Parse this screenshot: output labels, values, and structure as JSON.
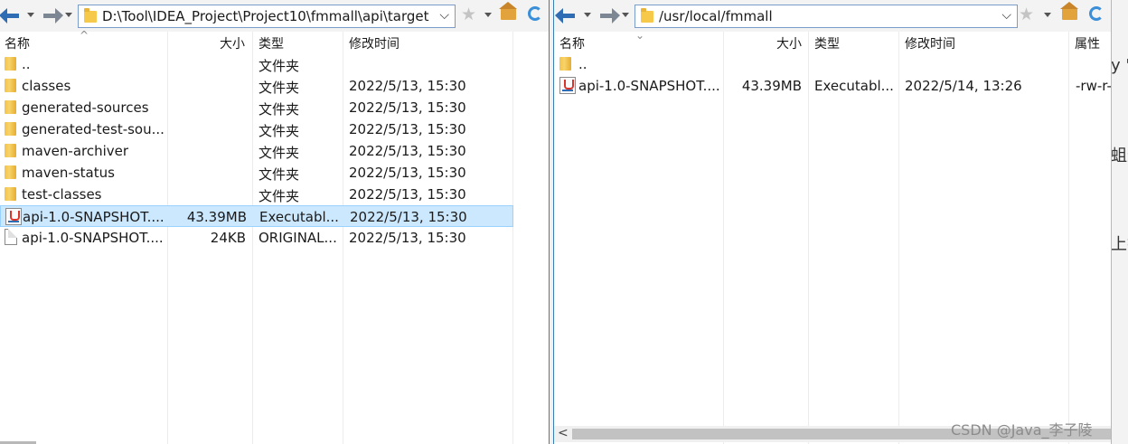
{
  "left": {
    "path": "D:\\Tool\\IDEA_Project\\Project10\\fmmall\\api\\target",
    "columns": {
      "name": "名称",
      "size": "大小",
      "type": "类型",
      "modified": "修改时间"
    },
    "rows": [
      {
        "icon": "folder-icon",
        "name": "..",
        "size": "",
        "type": "文件夹",
        "modified": ""
      },
      {
        "icon": "folder-icon",
        "name": "classes",
        "size": "",
        "type": "文件夹",
        "modified": "2022/5/13, 15:30"
      },
      {
        "icon": "folder-icon",
        "name": "generated-sources",
        "size": "",
        "type": "文件夹",
        "modified": "2022/5/13, 15:30"
      },
      {
        "icon": "folder-icon",
        "name": "generated-test-sou...",
        "size": "",
        "type": "文件夹",
        "modified": "2022/5/13, 15:30"
      },
      {
        "icon": "folder-icon",
        "name": "maven-archiver",
        "size": "",
        "type": "文件夹",
        "modified": "2022/5/13, 15:30"
      },
      {
        "icon": "folder-icon",
        "name": "maven-status",
        "size": "",
        "type": "文件夹",
        "modified": "2022/5/13, 15:30"
      },
      {
        "icon": "folder-icon",
        "name": "test-classes",
        "size": "",
        "type": "文件夹",
        "modified": "2022/5/13, 15:30"
      },
      {
        "icon": "java-file-icon",
        "name": "api-1.0-SNAPSHOT....",
        "size": "43.39MB",
        "type": "Executabl...",
        "modified": "2022/5/13, 15:30",
        "selected": true
      },
      {
        "icon": "file-icon",
        "name": "api-1.0-SNAPSHOT....",
        "size": "24KB",
        "type": "ORIGINAL...",
        "modified": "2022/5/13, 15:30"
      }
    ]
  },
  "right": {
    "path": "/usr/local/fmmall",
    "columns": {
      "name": "名称",
      "size": "大小",
      "type": "类型",
      "modified": "修改时间",
      "perms": "属性"
    },
    "rows": [
      {
        "icon": "folder-icon",
        "name": "..",
        "size": "",
        "type": "",
        "modified": "",
        "perms": ""
      },
      {
        "icon": "java-file-icon",
        "name": "api-1.0-SNAPSHOT....",
        "size": "43.39MB",
        "type": "Executabl...",
        "modified": "2022/5/14, 13:26",
        "perms": "-rw-r-"
      }
    ]
  },
  "background_fragments": [
    "y '",
    "蛆进",
    "上搜"
  ],
  "watermark": "CSDN @Java_李子陵",
  "colors": {
    "selection": "#cce8ff",
    "accent": "#2e6db4",
    "pane_border": "#3c7fb1"
  }
}
